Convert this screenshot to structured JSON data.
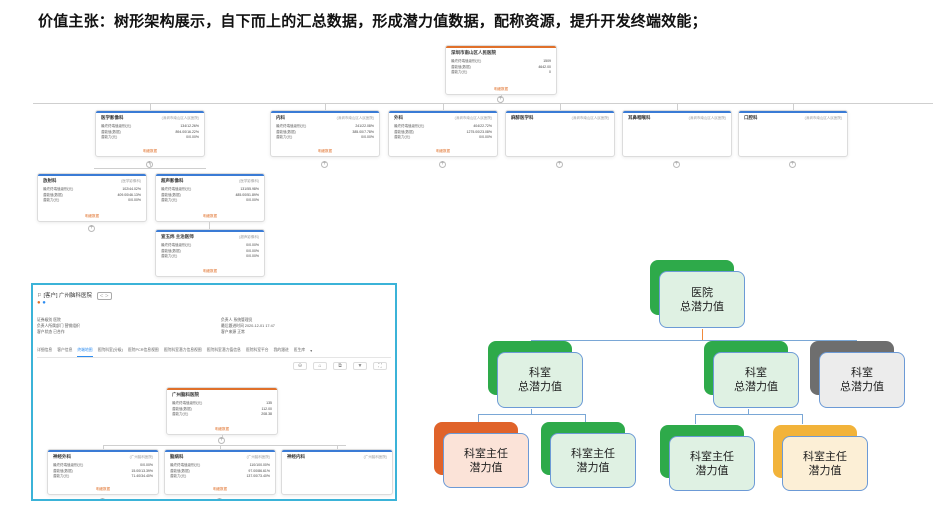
{
  "headline": "价值主张：树形架构展示，自下而上的汇总数据，形成潜力值数据，配称资源，提升开发终端效能；",
  "tree": {
    "root": {
      "name": "深圳市南山区人民医院",
      "rows": [
        [
          "最终终端值级别(元)",
          "1509"
        ],
        [
          "潜能值(数据)",
          "4642.00"
        ],
        [
          "潜能力(元)",
          "0"
        ]
      ],
      "more": "明细数据"
    },
    "level1": [
      {
        "name": "医学影像科",
        "sub": "(深圳市南山区人民医院)",
        "rows": [
          [
            "最终终端值级别(元)",
            "134/12.26%"
          ],
          [
            "潜能值(数据)",
            "894.00/16.22%"
          ],
          [
            "潜能力(元)",
            "0/0.00%"
          ]
        ],
        "more": "明细数据"
      },
      {
        "name": "内科",
        "sub": "(深圳市南山区人民医院)",
        "rows": [
          [
            "最终终端值级别(元)",
            "241/22.08%"
          ],
          [
            "潜能值(数据)",
            "385.00/7.78%"
          ],
          [
            "潜能力(元)",
            "0/0.00%"
          ]
        ],
        "more": "明细数据"
      },
      {
        "name": "外科",
        "sub": "(深圳市南山区人民医院)",
        "rows": [
          [
            "最终终端值级别(元)",
            "404/22.72%"
          ],
          [
            "潜能值(数据)",
            "1275.00/23.08%"
          ],
          [
            "潜能力(元)",
            "0/0.00%"
          ]
        ],
        "more": "明细数据"
      },
      {
        "name": "麻醉医学科",
        "sub": "(深圳市南山区人民医院)",
        "rows": [],
        "more": ""
      },
      {
        "name": "耳鼻咽喉科",
        "sub": "(深圳市南山区人民医院)",
        "rows": [],
        "more": ""
      },
      {
        "name": "口腔科",
        "sub": "(深圳市南山区人民医院)",
        "rows": [],
        "more": ""
      }
    ],
    "level2": [
      {
        "name": "放射科",
        "sub": "(医学影像科)",
        "rows": [
          [
            "最终终端值级别(元)",
            "102/44.02%"
          ],
          [
            "潜能值(数据)",
            "409.00/46.13%"
          ],
          [
            "潜能力(元)",
            "0/0.00%"
          ]
        ],
        "more": "明细数据"
      },
      {
        "name": "超声影像科",
        "sub": "(医学影像科)",
        "rows": [
          [
            "最终终端值级别(元)",
            "131/55.98%"
          ],
          [
            "潜能值(数据)",
            "485.00/51.89%"
          ],
          [
            "潜能力(元)",
            "0/0.00%"
          ]
        ],
        "more": "明细数据"
      }
    ],
    "level3": {
      "name": "宣玉炜 主治医师",
      "sub": "(超声影像科)",
      "rows": [
        [
          "最终终端值级别(元)",
          "0/0.00%"
        ],
        [
          "潜能值(数据)",
          "0/0.00%"
        ],
        [
          "潜能力(元)",
          "0/0.00%"
        ]
      ],
      "more": "明细数据"
    }
  },
  "panel": {
    "title": "[客户] 广州脑科医院",
    "tag": "＜ ＞",
    "info_left": [
      "证券级别  医院",
      "负责人所属部门  营销组织",
      "客户状态  已合作"
    ],
    "info_right": [
      "负责人  系统管理员",
      "最后跟进时间  2020-12-01 17:47",
      "客户来源  正常"
    ],
    "tabs": [
      "详细信息",
      "客户信息",
      "终端地图",
      "医院科室(分级)",
      "医院PCR信息视图",
      "医院科室潜力信息视图",
      "医院科室潜力值信息",
      "医院科室平台",
      "我的跟进",
      "医生库"
    ],
    "active_tab": 2,
    "tools": [
      "⊖",
      "⌂",
      "⧉",
      "▼",
      "⛶"
    ],
    "root": {
      "name": "广州脑科医院",
      "rows": [
        [
          "最终终端值级别(元)",
          "135"
        ],
        [
          "潜能值(数据)",
          "112.00"
        ],
        [
          "潜能力(元)",
          "208.38"
        ]
      ],
      "more": "明细数据"
    },
    "children": [
      {
        "name": "神经外科",
        "sub": "(广州脑科医院)",
        "rows": [
          [
            "最终终端值级别(元)",
            "0/0.00%"
          ],
          [
            "潜能值(数据)",
            "15.00/13.39%"
          ],
          [
            "潜能力(元)",
            "71.40/34.40%"
          ]
        ],
        "more": "明细数据"
      },
      {
        "name": "脑病科",
        "sub": "(广州脑科医院)",
        "rows": [
          [
            "最终终端值级别(元)",
            "110/100.00%"
          ],
          [
            "潜能值(数据)",
            "97.00/86.61%"
          ],
          [
            "潜能力(元)",
            "137.00/73.40%"
          ]
        ],
        "more": "明细数据"
      },
      {
        "name": "神经内科",
        "sub": "(广州脑科医院)",
        "rows": [],
        "more": ""
      }
    ]
  },
  "diagram": {
    "root": "医院\n总潜力值",
    "dept": [
      "科室\n总潜力值",
      "科室\n总潜力值",
      "科室\n总潜力值"
    ],
    "director": [
      "科室主任\n潜力值",
      "科室主任\n潜力值",
      "科室主任\n潜力值",
      "科室主任\n潜力值"
    ],
    "colors": {
      "green": "#2eaa4a",
      "gray": "#6e6e6e",
      "orange": "#e0632a",
      "yellow": "#f2b33a",
      "green_fill": "#dff1e3",
      "gray_fill": "#ececec",
      "orange_fill": "#fbe3d8",
      "yellow_fill": "#fcefd6",
      "accent_line": "#f08a3c"
    }
  }
}
